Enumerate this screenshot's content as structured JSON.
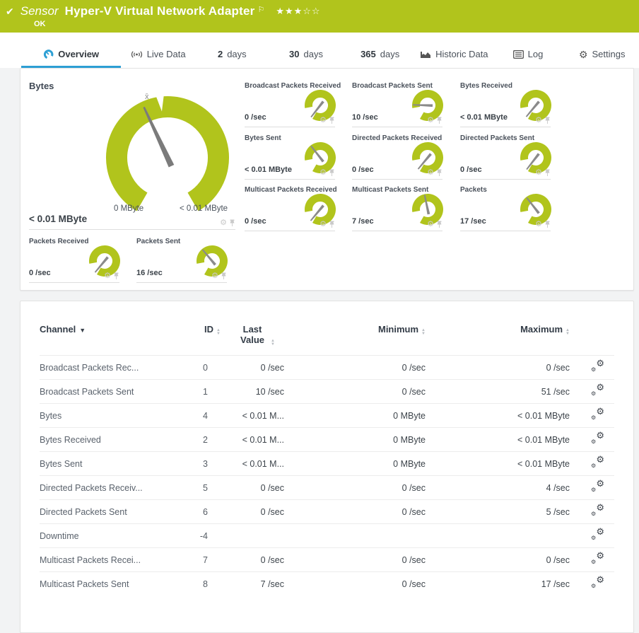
{
  "header": {
    "kind_label": "Sensor",
    "title": "Hyper-V Virtual Network Adapter",
    "status": "OK",
    "rating_filled": 3,
    "rating_empty": 2
  },
  "tabs": [
    {
      "id": "overview",
      "label": "Overview",
      "icon": "gauge-icon",
      "active": true
    },
    {
      "id": "live-data",
      "label": "Live Data",
      "icon": "live-data-icon"
    },
    {
      "id": "2-days",
      "number": "2",
      "label": "days"
    },
    {
      "id": "30-days",
      "number": "30",
      "label": "days"
    },
    {
      "id": "365-days",
      "number": "365",
      "label": "days"
    },
    {
      "id": "historic-data",
      "label": "Historic Data",
      "icon": "historic-data-icon"
    },
    {
      "id": "log",
      "label": "Log",
      "icon": "log-icon"
    },
    {
      "id": "settings",
      "label": "Settings",
      "icon": "settings-gear-icon"
    }
  ],
  "primary_gauge": {
    "title": "Bytes",
    "value": "< 0.01 MByte",
    "scale_min": "0 MByte",
    "scale_max": "< 0.01 MByte",
    "avg_marker": "x̄",
    "needle_angle": -25
  },
  "small_gauges": [
    {
      "title": "Broadcast Packets Received",
      "value": "0 /sec",
      "needle_angle": -142
    },
    {
      "title": "Broadcast Packets Sent",
      "value": "10 /sec",
      "needle_angle": -88
    },
    {
      "title": "Bytes Received",
      "value": "< 0.01 MByte",
      "needle_angle": -140
    },
    {
      "title": "Bytes Sent",
      "value": "< 0.01 MByte",
      "needle_angle": -38
    },
    {
      "title": "Directed Packets Received",
      "value": "0 /sec",
      "needle_angle": -140
    },
    {
      "title": "Directed Packets Sent",
      "value": "0 /sec",
      "needle_angle": -142
    },
    {
      "title": "Multicast Packets Received",
      "value": "0 /sec",
      "needle_angle": -140
    },
    {
      "title": "Multicast Packets Sent",
      "value": "7 /sec",
      "needle_angle": -12
    },
    {
      "title": "Packets",
      "value": "17 /sec",
      "needle_angle": -38
    },
    {
      "title": "Packets Received",
      "value": "0 /sec",
      "needle_angle": -140
    },
    {
      "title": "Packets Sent",
      "value": "16 /sec",
      "needle_angle": -40
    }
  ],
  "channels_table": {
    "columns": [
      {
        "label": "Channel",
        "sorted": "desc"
      },
      {
        "label": "ID",
        "sortable": true
      },
      {
        "label": "Last Value",
        "sortable": true
      },
      {
        "label": "Minimum",
        "sortable": true
      },
      {
        "label": "Maximum",
        "sortable": true
      }
    ],
    "rows": [
      {
        "channel": "Broadcast Packets Rec...",
        "id": "0",
        "last_value": "0 /sec",
        "minimum": "0 /sec",
        "maximum": "0 /sec"
      },
      {
        "channel": "Broadcast Packets Sent",
        "id": "1",
        "last_value": "10 /sec",
        "minimum": "0 /sec",
        "maximum": "51 /sec"
      },
      {
        "channel": "Bytes",
        "id": "4",
        "last_value": "< 0.01 M...",
        "minimum": "0 MByte",
        "maximum": "< 0.01 MByte"
      },
      {
        "channel": "Bytes Received",
        "id": "2",
        "last_value": "< 0.01 M...",
        "minimum": "0 MByte",
        "maximum": "< 0.01 MByte"
      },
      {
        "channel": "Bytes Sent",
        "id": "3",
        "last_value": "< 0.01 M...",
        "minimum": "0 MByte",
        "maximum": "< 0.01 MByte"
      },
      {
        "channel": "Directed Packets Receiv...",
        "id": "5",
        "last_value": "0 /sec",
        "minimum": "0 /sec",
        "maximum": "4 /sec"
      },
      {
        "channel": "Directed Packets Sent",
        "id": "6",
        "last_value": "0 /sec",
        "minimum": "0 /sec",
        "maximum": "5 /sec"
      },
      {
        "channel": "Downtime",
        "id": "-4",
        "last_value": "",
        "minimum": "",
        "maximum": ""
      },
      {
        "channel": "Multicast Packets Recei...",
        "id": "7",
        "last_value": "0 /sec",
        "minimum": "0 /sec",
        "maximum": "0 /sec"
      },
      {
        "channel": "Multicast Packets Sent",
        "id": "8",
        "last_value": "7 /sec",
        "minimum": "0 /sec",
        "maximum": "17 /sec"
      }
    ]
  },
  "colors": {
    "status_green": "#b1c41c",
    "accent_blue": "#2d9fd4",
    "needle_gray": "#7b7b7b"
  }
}
